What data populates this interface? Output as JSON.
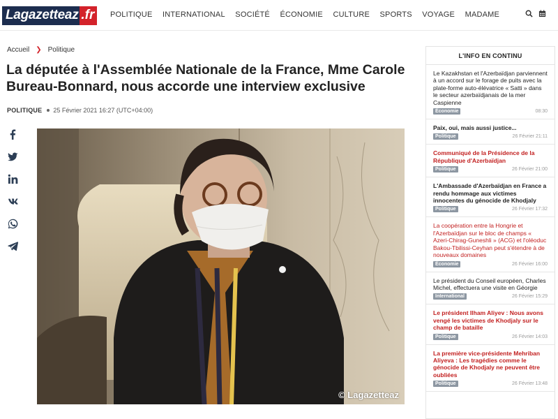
{
  "logo": {
    "part1": "Lagazetteaz",
    "part2": ".fr"
  },
  "nav": [
    "POLITIQUE",
    "INTERNATIONAL",
    "SOCIÉTÉ",
    "ÉCONOMIE",
    "CULTURE",
    "SPORTS",
    "VOYAGE",
    "MADAME"
  ],
  "icons": {
    "search": "search-icon",
    "calendar": "calendar-icon"
  },
  "breadcrumb": {
    "home": "Accueil",
    "section": "Politique"
  },
  "article": {
    "title": "La députée à l'Assemblée Nationale de la France, Mme Carole Bureau-Bonnard, nous accorde une interview exclusive",
    "category": "POLITIQUE",
    "date": "25 Février 2021 16:27 (UTC+04:00)",
    "photo_credit": "© Lagazetteaz"
  },
  "social": [
    "facebook-icon",
    "twitter-icon",
    "linkedin-icon",
    "vk-icon",
    "whatsapp-icon",
    "telegram-icon"
  ],
  "sidebar": {
    "header": "L'INFO EN CONTINU",
    "items": [
      {
        "text": "Le Kazakhstan et l'Azerbaïdjan parviennent à un accord sur le forage de puits avec la plate-forme auto-élévatrice « Satti » dans le secteur azerbaïdjanais de la mer Caspienne",
        "style": "plain",
        "badge": "Économie",
        "time": "08:30"
      },
      {
        "text": "Paix, oui, mais aussi justice...",
        "style": "bold",
        "badge": "Politique",
        "time": "26 Février 21:11"
      },
      {
        "text": "Communiqué de la Présidence de la République d'Azerbaïdjan",
        "style": "red",
        "badge": "Politique",
        "time": "26 Février 21:00"
      },
      {
        "text": "L'Ambassade d'Azerbaïdjan en France a rendu hommage aux victimes innocentes du génocide de Khodjaly",
        "style": "bold",
        "badge": "Politique",
        "time": "26 Février 17:32"
      },
      {
        "text": "La coopération entre la Hongrie et l'Azerbaïdjan sur le bloc de champs « Azeri-Chirag-Guneshli » (ACG) et l'oléoduc Bakou-Tbilissi-Ceyhan peut s'étendre à de nouveaux domaines",
        "style": "redplain",
        "badge": "Économie",
        "time": "26 Février 16:00"
      },
      {
        "text": "Le président du Conseil européen, Charles Michel, effectuera une visite en Géorgie",
        "style": "plain",
        "badge": "International",
        "time": "26 Février 15:29"
      },
      {
        "text": "Le président Ilham Aliyev : Nous avons vengé les victimes de Khodjaly sur le champ de bataille",
        "style": "red",
        "badge": "Politique",
        "time": "26 Février 14:03"
      },
      {
        "text": "La première vice-présidente Mehriban Aliyeva : Les tragédies comme le génocide de Khodjaly ne peuvent être oubliées",
        "style": "red",
        "badge": "Politique",
        "time": "26 Février 13:48"
      }
    ]
  },
  "colors": {
    "brand_navy": "#1c2d4f",
    "brand_red": "#d3222a",
    "badge_gray": "#8d97a2"
  }
}
